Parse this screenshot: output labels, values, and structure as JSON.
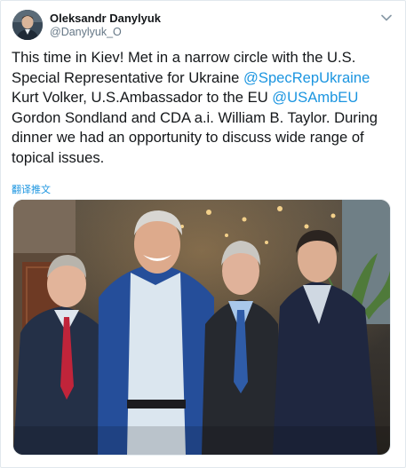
{
  "tweet": {
    "author": {
      "display_name": "Oleksandr Danylyuk",
      "handle": "@Danylyuk_O"
    },
    "menu_icon": "chevron-down-icon",
    "text_parts": {
      "part1": "This time in Kiev! Met in a narrow circle with the U.S. Special Representative for Ukraine ",
      "mention1": "@SpecRepUkraine",
      "part2": " Kurt Volker, U.S.Ambassador to the EU ",
      "mention2": "@USAmbEU",
      "part3": " Gordon Sondland and CDA a.i. William B. Taylor. During dinner we had an opportunity to discuss wide range of topical issues."
    },
    "translate_label": "翻译推文",
    "colors": {
      "link": "#1b95e0",
      "text": "#14171a",
      "secondary": "#657786"
    }
  }
}
